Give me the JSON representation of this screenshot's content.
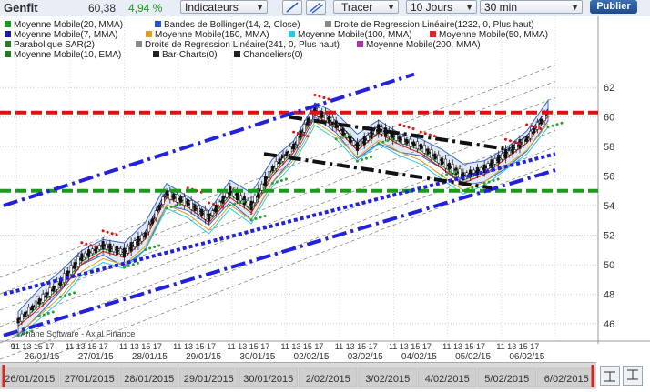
{
  "toolbar": {
    "ticker": "Genfit",
    "price": "60,38",
    "change": "4,94 %",
    "indicators_label": "Indicateurs",
    "trace_label": "Tracer",
    "period_label": "10 Jours",
    "interval_label": "30 min",
    "publish_label": "Publier"
  },
  "legend": [
    {
      "label": "Moyenne Mobile(20, MMA)",
      "color": "#1a9a1a"
    },
    {
      "label": "Bandes de Bollinger(14, 2, Close)",
      "color": "#2255cc"
    },
    {
      "label": "Droite de Regression Linéaire(1232, 0, Plus haut)",
      "color": "#888888"
    },
    {
      "label": "Moyenne Mobile(7, MMA)",
      "color": "#1a1aa8"
    },
    {
      "label": "Moyenne Mobile(150, MMA)",
      "color": "#e0a020"
    },
    {
      "label": "Moyenne Mobile(100, MMA)",
      "color": "#22ccee"
    },
    {
      "label": "Moyenne Mobile(50, MMA)",
      "color": "#dd2222"
    },
    {
      "label": "Parabolique SAR(2)",
      "color": "#2a7a2a"
    },
    {
      "label": "Droite de Regression Linéaire(241, 0, Plus haut)",
      "color": "#888888"
    },
    {
      "label": "Moyenne Mobile(200, MMA)",
      "color": "#aa33aa"
    },
    {
      "label": "Moyenne Mobile(10, EMA)",
      "color": "#2a7a2a"
    },
    {
      "label": "Bar-Charts(0)",
      "color": "#222222"
    },
    {
      "label": "Chandeliers(0)",
      "color": "#222222"
    }
  ],
  "source": "© Ariane Software - Axial Finance",
  "chart_data": {
    "type": "line",
    "ylim": [
      45,
      63
    ],
    "y_ticks": [
      "46",
      "48",
      "50",
      "52",
      "54",
      "56",
      "58",
      "60",
      "62"
    ],
    "hours_row": [
      "9",
      "11 13 15 17",
      "11 13 15 17",
      "11 13 15 17",
      "11 13 15 17",
      "11 13 15 17",
      "11 13 15 17",
      "11 13 15 17",
      "11 13 15 17",
      "11 13 15 17",
      "11 13 15 17"
    ],
    "day_labels": [
      "26/01/15",
      "27/01/15",
      "28/01/15",
      "29/01/15",
      "30/01/15",
      "02/02/15",
      "03/02/15",
      "04/02/15",
      "05/02/15",
      "06/02/15"
    ],
    "scroll_labels": [
      "26/01/2015",
      "27/01/2015",
      "28/01/2015",
      "29/01/2015",
      "30/01/2015",
      "2/02/2015",
      "3/02/2015",
      "4/02/2015",
      "5/02/2015",
      "6/02/2015"
    ],
    "resistance": 60.3,
    "support": 55.0,
    "series": [
      {
        "values": [
          46.2,
          47.5,
          48.8,
          50.5,
          51.3,
          50.8,
          52.0,
          54.8,
          54.2,
          53.2,
          55.0,
          54.0,
          56.5,
          58.0,
          60.5,
          59.5,
          58.0,
          59.2,
          58.5,
          58.0,
          57.0,
          56.0,
          56.5,
          57.5,
          58.5,
          60.3
        ]
      }
    ],
    "colors": {
      "resistance": "#e01010",
      "support": "#1a9a1a",
      "channel": "#2222dd",
      "trendline": "#111111",
      "bollinger": "#3366cc"
    }
  }
}
